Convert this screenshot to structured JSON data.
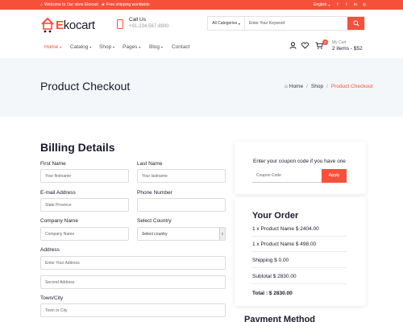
{
  "topbar": {
    "welcome": "Welcome to Our store Ekocart",
    "shipping": "Free shipping worldwide",
    "language": "English",
    "social_icons": [
      "facebook-icon",
      "twitter-icon",
      "linkedin-icon",
      "instagram-icon"
    ],
    "bg_color": "#f5503a"
  },
  "header": {
    "brand_initial": "E",
    "brand_rest": "kocart",
    "phone_label": "Call Us",
    "phone_number": "+91-234-567-8900",
    "search_category": "All Categories",
    "search_placeholder": "Enter Your Keyword"
  },
  "nav": {
    "items": [
      {
        "label": "Home",
        "active": true
      },
      {
        "label": "Catalog",
        "active": false
      },
      {
        "label": "Shop",
        "active": false
      },
      {
        "label": "Pages",
        "active": false
      },
      {
        "label": "Blog",
        "active": false
      },
      {
        "label": "Contact",
        "active": false
      }
    ],
    "cart_count": "0",
    "cart_label": "My Cart",
    "cart_summary": "2 items - $52"
  },
  "hero": {
    "title": "Product Checkout",
    "breadcrumb": [
      "Home",
      "Shop",
      "Product Checkout"
    ]
  },
  "billing": {
    "title": "Billing Details",
    "first_name_label": "First Name",
    "first_name_placeholder": "Your firstname",
    "last_name_label": "Last Name",
    "last_name_placeholder": "Your lastname",
    "email_label": "E-mail Address",
    "email_placeholder": "State Province",
    "phone_label": "Phone Number",
    "phone_placeholder": "",
    "company_label": "Company Name",
    "company_placeholder": "Company Name",
    "country_label": "Select Country",
    "country_value": "Select country",
    "address_label": "Address",
    "address1_placeholder": "Enter Your Address",
    "address2_placeholder": "Second Address",
    "town_label": "Town/City",
    "town_placeholder": "Town or City"
  },
  "coupon": {
    "title": "Enter your coupon code if you have one",
    "placeholder": "Coupon Code",
    "apply_label": "Apply"
  },
  "order": {
    "title": "Your Order",
    "lines": [
      "1 x Product Name $ 2404.00",
      "1 x Product Name $ 498.00"
    ],
    "shipping": "Shipping $ 0.00",
    "subtotal": "Subtotal $ 2830.00",
    "total": "Total : $ 2830.00"
  },
  "payment": {
    "title": "Payment Method"
  },
  "colors": {
    "accent": "#f5503a",
    "hero_bg": "#f4f7fa",
    "text": "#1a1a2e"
  }
}
